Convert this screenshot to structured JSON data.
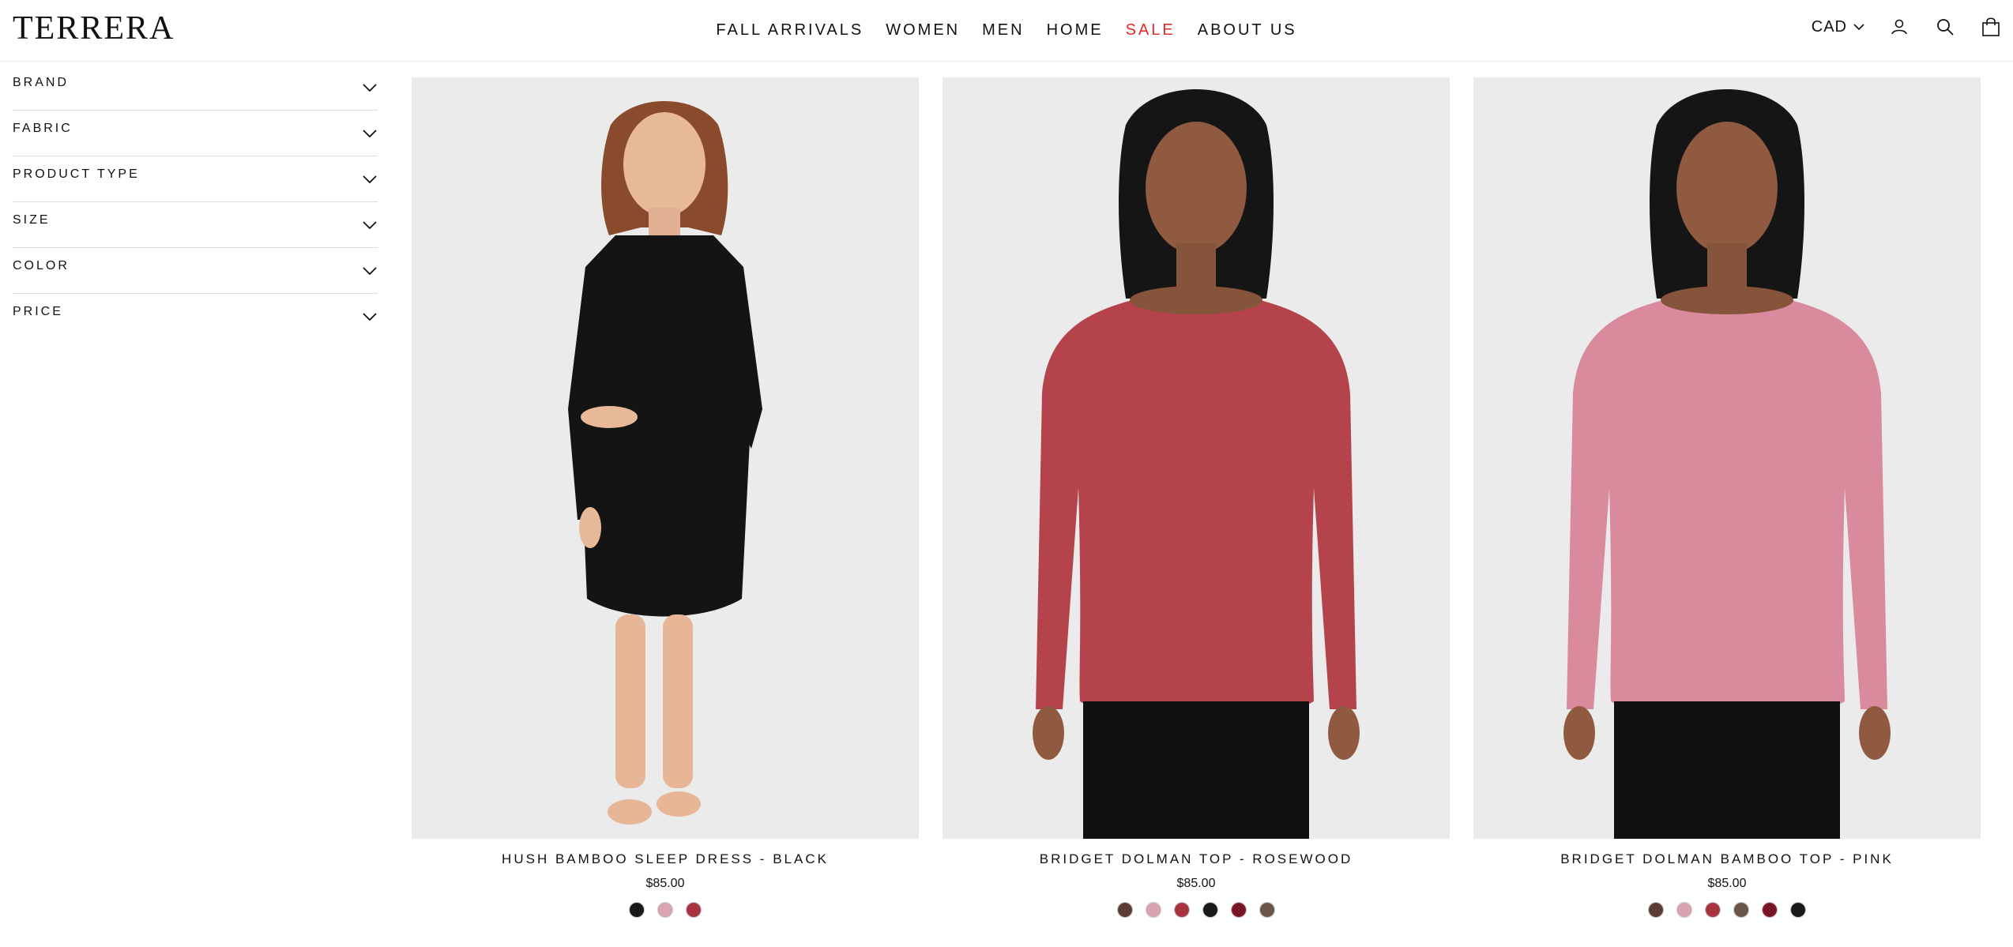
{
  "header": {
    "logo": "TERRERA",
    "nav": [
      {
        "label": "FALL ARRIVALS",
        "sale": false
      },
      {
        "label": "WOMEN",
        "sale": false
      },
      {
        "label": "MEN",
        "sale": false
      },
      {
        "label": "HOME",
        "sale": false
      },
      {
        "label": "SALE",
        "sale": true
      },
      {
        "label": "ABOUT US",
        "sale": false
      }
    ],
    "currency": "CAD",
    "icons": [
      "user-icon",
      "search-icon",
      "cart-icon"
    ]
  },
  "colors": {
    "sale": "#e02b2b",
    "text": "#111111",
    "image_bg": "#ebebeb"
  },
  "filters": [
    "BRAND",
    "FABRIC",
    "PRODUCT TYPE",
    "SIZE",
    "COLOR",
    "PRICE"
  ],
  "products": [
    {
      "title": "HUSH BAMBOO SLEEP DRESS - BLACK",
      "price": "$85.00",
      "garment": "dress",
      "garment_color": "#141414",
      "swatches": [
        "#1a1a1a",
        "#d9a3af",
        "#a8343f"
      ]
    },
    {
      "title": "BRIDGET DOLMAN TOP - ROSEWOOD",
      "price": "$85.00",
      "garment": "top",
      "garment_color": "#b5434c",
      "swatches": [
        "#5a3b35",
        "#d9a3af",
        "#a8343f",
        "#1a1a1a",
        "#7a1424",
        "#6b5549"
      ]
    },
    {
      "title": "BRIDGET DOLMAN BAMBOO TOP - PINK",
      "price": "$85.00",
      "garment": "top",
      "garment_color": "#d98a9d",
      "swatches": [
        "#5a3b35",
        "#d9a3af",
        "#a8343f",
        "#6b5549",
        "#7a1424",
        "#1a1a1a"
      ]
    }
  ]
}
